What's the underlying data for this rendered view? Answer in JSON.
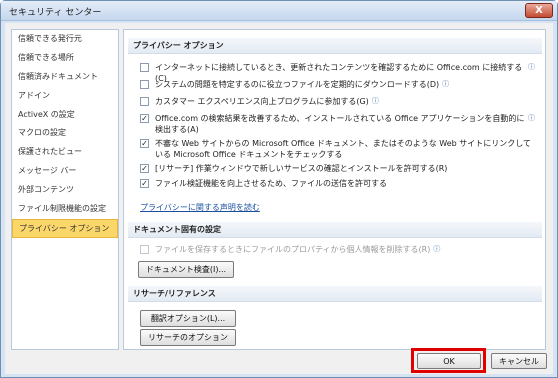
{
  "window": {
    "title": "セキュリティ センター",
    "close_label": "X"
  },
  "sidebar": {
    "items": [
      {
        "label": "信頼できる発行元",
        "active": false
      },
      {
        "label": "信頼できる場所",
        "active": false
      },
      {
        "label": "信頼済みドキュメント",
        "active": false
      },
      {
        "label": "アドイン",
        "active": false
      },
      {
        "label": "ActiveX の設定",
        "active": false
      },
      {
        "label": "マクロの設定",
        "active": false
      },
      {
        "label": "保護されたビュー",
        "active": false
      },
      {
        "label": "メッセージ バー",
        "active": false
      },
      {
        "label": "外部コンテンツ",
        "active": false
      },
      {
        "label": "ファイル制限機能の設定",
        "active": false
      },
      {
        "label": "プライバシー オプション",
        "active": true
      }
    ]
  },
  "privacy": {
    "header": "プライバシー オプション",
    "options": [
      {
        "label": "インターネットに接続しているとき、更新されたコンテンツを確認するために Office.com に接続する(C)",
        "checked": false,
        "disabled": false
      },
      {
        "label": "システムの問題を特定するのに役立つファイルを定期的にダウンロードする(D)",
        "checked": false,
        "disabled": false
      },
      {
        "label": "カスタマー エクスペリエンス向上プログラムに参加する(G)",
        "checked": false,
        "disabled": false
      },
      {
        "label": "Office.com の検索結果を改善するため、インストールされている Office アプリケーションを自動的に検出する(A)",
        "checked": true,
        "disabled": false
      },
      {
        "label": "不審な Web サイトからの Microsoft Office ドキュメント、またはそのような Web サイトにリンクしている Microsoft Office ドキュメントをチェックする",
        "checked": true,
        "disabled": false
      },
      {
        "label": "[リサーチ] 作業ウィンドウで新しいサービスの確認とインストールを許可する(R)",
        "checked": true,
        "disabled": false
      },
      {
        "label": "ファイル検証機能を向上させるため、ファイルの送信を許可する",
        "checked": true,
        "disabled": false
      }
    ],
    "link": "プライバシーに関する声明を読む"
  },
  "document": {
    "header": "ドキュメント固有の設定",
    "option": {
      "label": "ファイルを保存するときにファイルのプロパティから個人情報を削除する(R)",
      "checked": false,
      "disabled": true
    },
    "inspect_button": "ドキュメント検査(I)..."
  },
  "research": {
    "header": "リサーチ/リファレンス",
    "translation_button": "翻訳オプション(L)...",
    "research_button": "リサーチのオプション(H)..."
  },
  "footer": {
    "ok": "OK",
    "cancel": "キャンセル"
  },
  "icons": {
    "info": "info-icon",
    "close": "close-icon",
    "check": "check-icon"
  },
  "colors": {
    "highlight": "#e00000",
    "active_item": "#fbd76a",
    "link": "#1a4fa0"
  }
}
